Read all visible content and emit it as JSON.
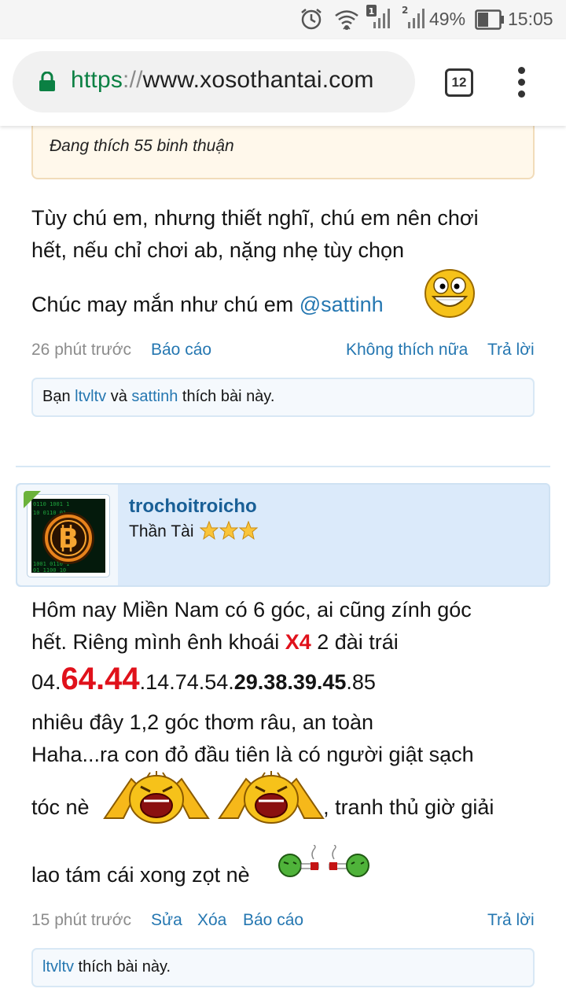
{
  "status_bar": {
    "sim1_badge": "1",
    "sim2_badge": "2",
    "battery_percent": "49%",
    "time": "15:05",
    "icons": [
      "alarm-icon",
      "wifi-icon",
      "signal-icon",
      "signal-icon",
      "battery-icon"
    ]
  },
  "browser": {
    "url_scheme": "https",
    "url_sep": "://",
    "url_host": "www.xosothantai.com",
    "tab_count": "12",
    "colors": {
      "secure": "#0b8043"
    }
  },
  "post1": {
    "quote_text": "Đang thích 55 binh thuận",
    "line1": "Tùy chú em, nhưng thiết nghĩ, chú em nên chơi",
    "line2": "hết, nếu chỉ chơi ab, nặng nhẹ tùy chọn",
    "line3_text": "Chúc may mắn như chú em ",
    "line3_mention": "@sattinh",
    "time": "26 phút trước",
    "report": "Báo cáo",
    "unlike": "Không thích nữa",
    "reply": "Trả lời",
    "likes_prefix": "Bạn ",
    "likes_user1": "ltvltv",
    "likes_and": " và ",
    "likes_user2": "sattinh",
    "likes_suffix": " thích bài này."
  },
  "post2": {
    "username": "trochoitroicho",
    "user_title": "Thần Tài",
    "star_count": 3,
    "line1": "Hôm nay Miền Nam có 6 góc, ai cũng zính góc",
    "line2_pre": "hết. Riêng mình ênh khoái ",
    "line2_x4": "X4",
    "line2_post": " 2 đài trái",
    "line3_a": "04.",
    "line3_big": "64.44",
    "line3_b": ".14.74.54.",
    "line3_bold": "29.38.39.45",
    "line3_c": ".85",
    "line4": "nhiêu đây 1,2 góc thơm râu, an toàn",
    "line5": "Haha...ra con đỏ đầu tiên là có người giật sạch",
    "line6_pre": "tóc nè ",
    "line6_post": ", tranh thủ giờ giải",
    "line7": "lao tám cái xong zọt nè ",
    "time": "15 phút trước",
    "edit": "Sửa",
    "delete": "Xóa",
    "report": "Báo cáo",
    "reply": "Trả lời",
    "likes_user": "ltvltv",
    "likes_suffix": " thích bài này."
  }
}
